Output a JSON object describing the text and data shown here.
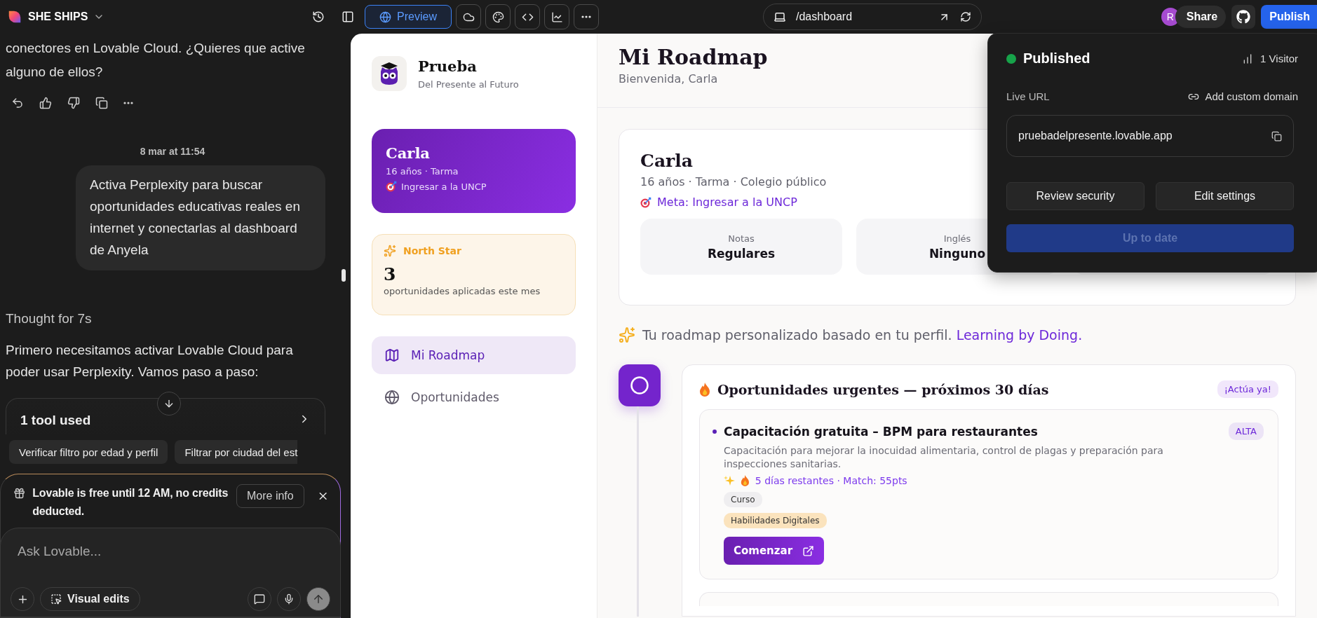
{
  "topbar": {
    "project": "SHE SHIPS",
    "preview": "Preview",
    "url": "/dashboard",
    "avatar": "R",
    "share": "Share",
    "publish": "Publish"
  },
  "chat": {
    "previous_text": "conectores en Lovable Cloud. ¿Quieres que active alguno de ellos?",
    "timestamp": "8 mar at 11:54",
    "user_message": "Activa Perplexity para buscar oportunidades educativas reales en internet y conectarlas al dashboard de Anyela",
    "thought": "Thought for 7s",
    "reply": "Primero necesitamos activar Lovable Cloud para poder usar Perplexity. Vamos paso a paso:",
    "tool": "1 tool used",
    "suggestions": [
      "Verificar filtro por edad y perfil",
      "Filtrar por ciudad del est"
    ],
    "banner": {
      "text": "Lovable is free until 12 AM, no credits deducted.",
      "button": "More info"
    },
    "input": {
      "placeholder": "Ask Lovable..."
    },
    "visual_edits": "Visual edits"
  },
  "sidebar": {
    "brand": "Prueba",
    "tagline": "Del Presente al Futuro",
    "profile": {
      "name": "Carla",
      "details": "16 años · Tarma",
      "goal": "Ingresar a la UNCP"
    },
    "north_star": {
      "label": "North Star",
      "value": "3",
      "caption": "oportunidades aplicadas este mes"
    },
    "items": [
      {
        "label": "Mi Roadmap",
        "selected": true
      },
      {
        "label": "Oportunidades",
        "selected": false
      }
    ]
  },
  "main": {
    "title": "Mi Roadmap",
    "subtitle": "Bienvenida, Carla",
    "profile": {
      "name": "Carla",
      "details": "16 años · Tarma · Colegio público",
      "goal": "Meta: Ingresar a la UNCP",
      "stats": [
        {
          "label": "Notas",
          "value": "Regulares"
        },
        {
          "label": "Inglés",
          "value": "Ninguno"
        }
      ]
    },
    "intro": "Tu roadmap personalizado basado en tu perfil.",
    "intro_link": "Learning by Doing.",
    "section": {
      "title": "Oportunidades urgentes — próximos 30 días",
      "badge": "¡Actúa ya!",
      "opportunities": [
        {
          "title": "Capacitación gratuita – BPM para restaurantes",
          "priority": "ALTA",
          "description": "Capacitación para mejorar la inocuidad alimentaria, control de plagas y preparación para inspecciones sanitarias.",
          "meta": "5 días restantes · Match: 55pts",
          "type": "Curso",
          "tags": [
            "Habilidades Digitales"
          ],
          "action": "Comenzar"
        }
      ]
    }
  },
  "publish_popup": {
    "status": "Published",
    "visitors": "1 Visitor",
    "live_url_label": "Live URL",
    "add_domain": "Add custom domain",
    "url": "pruebadelpresente.lovable.app",
    "buttons": [
      "Review security",
      "Edit settings"
    ],
    "update": {
      "label": "Up to date",
      "disabled": true
    }
  }
}
